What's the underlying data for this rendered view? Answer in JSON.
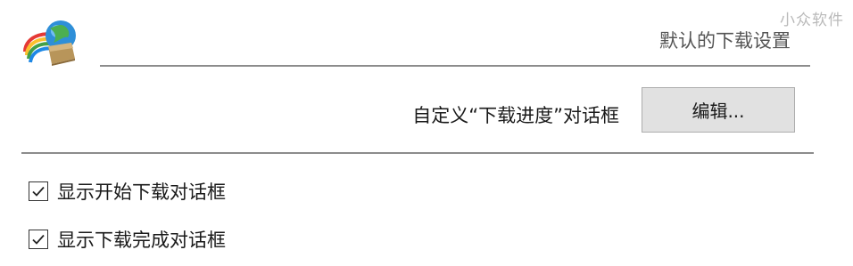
{
  "watermark": "小众软件",
  "section_title": "默认的下载设置",
  "custom_dialog": {
    "label": "自定义“下载进度”对话框",
    "edit_button": "编辑..."
  },
  "checkboxes": [
    {
      "label": "显示开始下载对话框",
      "checked": true
    },
    {
      "label": "显示下载完成对话框",
      "checked": true
    }
  ],
  "icons": {
    "app_logo": "idm-globe-logo-icon",
    "check": "checkmark-icon"
  },
  "colors": {
    "button_bg": "#e1e1e1",
    "rule": "#8c8c8c",
    "title_text": "#555555"
  }
}
